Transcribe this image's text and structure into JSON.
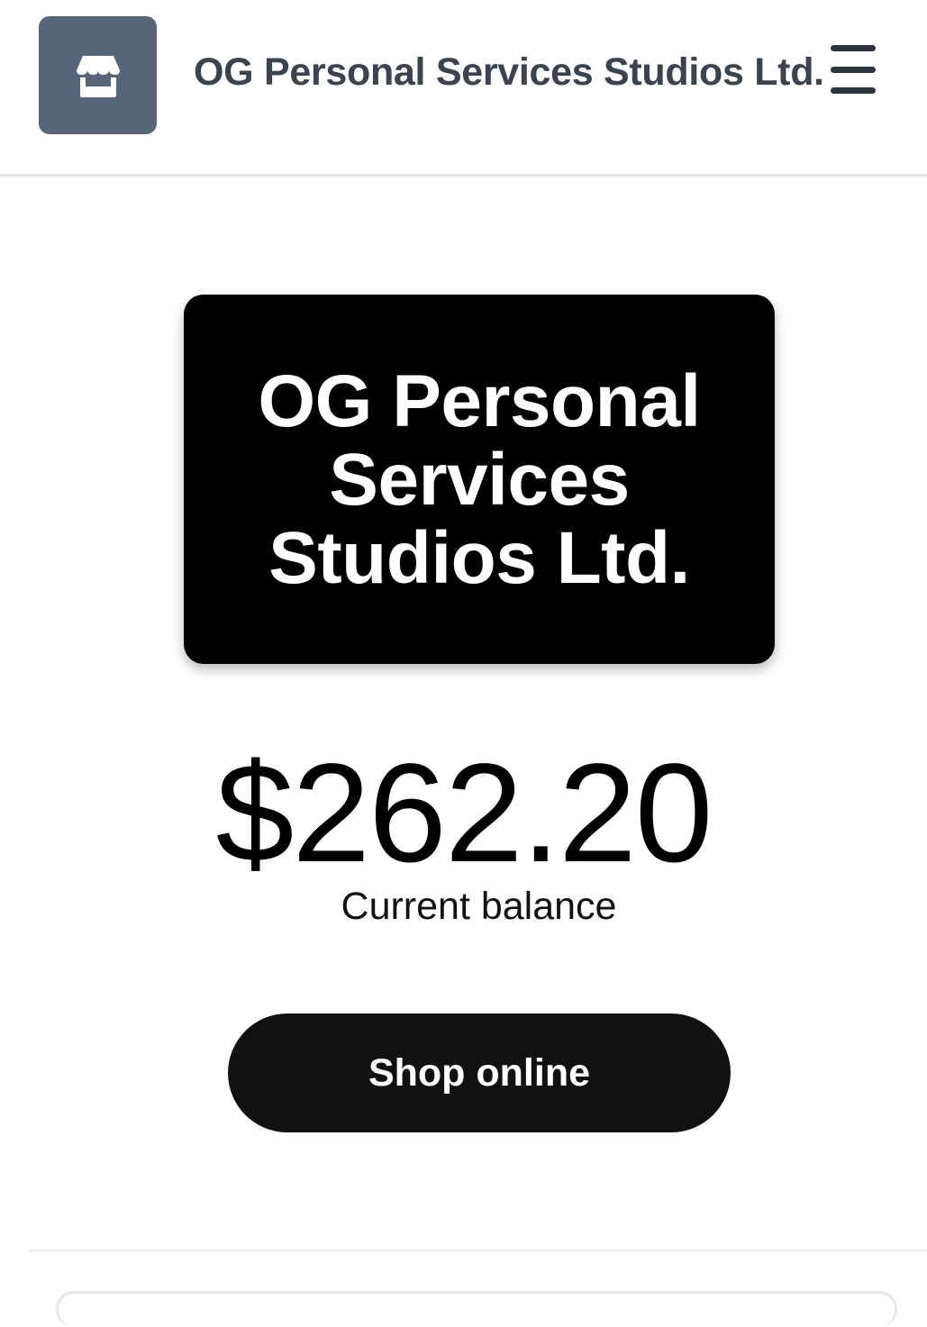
{
  "header": {
    "logo_icon": "storefront-icon",
    "shop_name": "OG Personal Services Studios Ltd.",
    "menu_icon": "hamburger-menu-icon"
  },
  "gift_card": {
    "name": "OG Personal Services Studios Ltd."
  },
  "balance": {
    "amount": "$262.20",
    "label": "Current balance"
  },
  "actions": {
    "shop_online_label": "Shop online"
  },
  "colors": {
    "logo_tile": "#566577",
    "card_background": "#000000",
    "button_background": "#111111",
    "header_text": "#3a4350"
  }
}
